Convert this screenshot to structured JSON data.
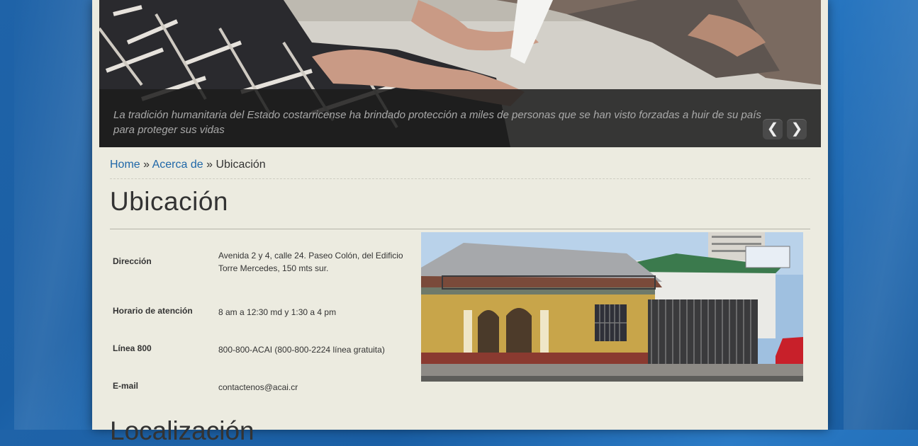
{
  "slider": {
    "caption": "La tradición humanitaria del Estado costarricense ha brindado protección a miles de personas que se han visto forzadas a huir de su país para proteger sus vidas",
    "prev_label": "❮",
    "next_label": "❯"
  },
  "breadcrumb": {
    "home": "Home",
    "sep1": " » ",
    "about": "Acerca de",
    "sep2": " » ",
    "current": "Ubicación"
  },
  "page": {
    "title": "Ubicación",
    "next_heading": "Localización"
  },
  "info": [
    {
      "label": "Dirección",
      "value": "Avenida 2 y 4, calle 24. Paseo Colón, del Edificio Torre Mercedes, 150 mts sur."
    },
    {
      "label": "Horario de atención",
      "value": "8 am a 12:30 md y 1:30 a 4 pm"
    },
    {
      "label": "Línea 800",
      "value": "800-800-ACAI (800-800-2224 línea gratuita)"
    },
    {
      "label": "E-mail",
      "value": "contactenos@acai.cr"
    }
  ],
  "colors": {
    "link": "#1f67a8",
    "page_bg": "#ecebe0",
    "body_bg": "#1f63a8"
  }
}
